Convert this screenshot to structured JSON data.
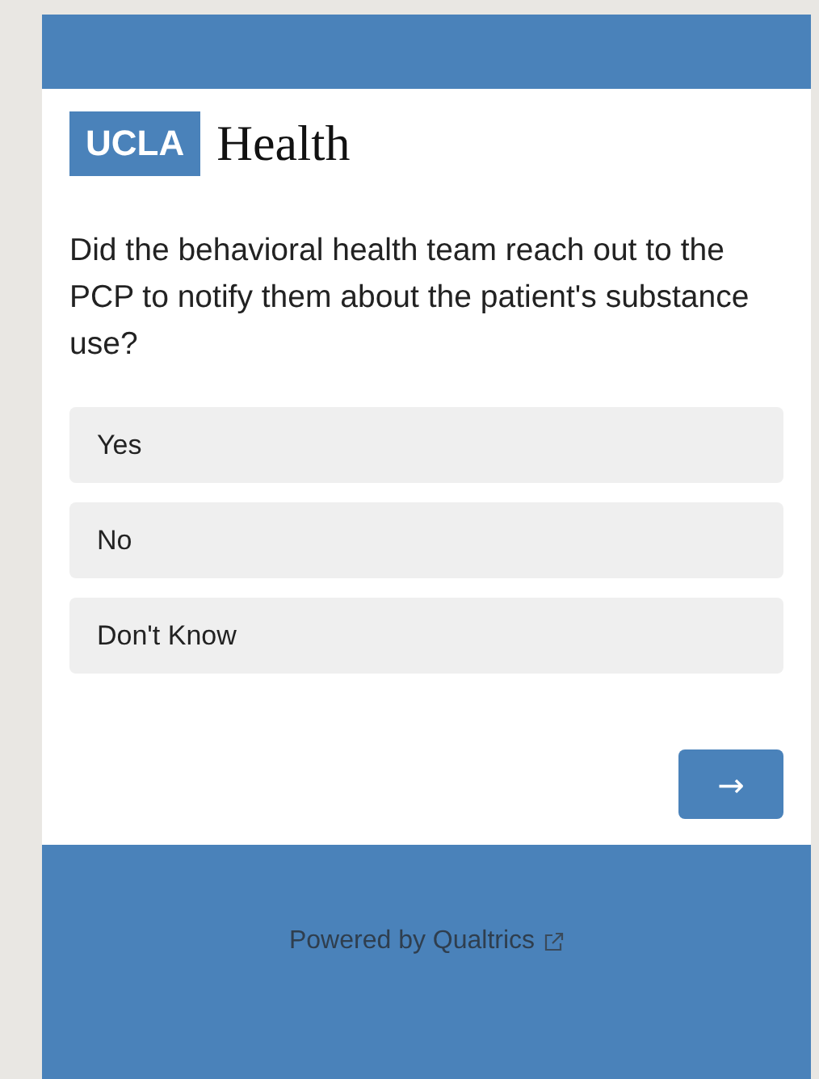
{
  "logo": {
    "mark": "UCLA",
    "name": "Health"
  },
  "question": "Did the behavioral health team reach out to the PCP to notify them about the patient's substance use?",
  "choices": [
    {
      "label": "Yes",
      "selected": false
    },
    {
      "label": "No",
      "selected": false
    },
    {
      "label": "Don't Know",
      "selected": false
    }
  ],
  "next_button": "→",
  "footer": {
    "link": "Powered by Qualtrics"
  }
}
